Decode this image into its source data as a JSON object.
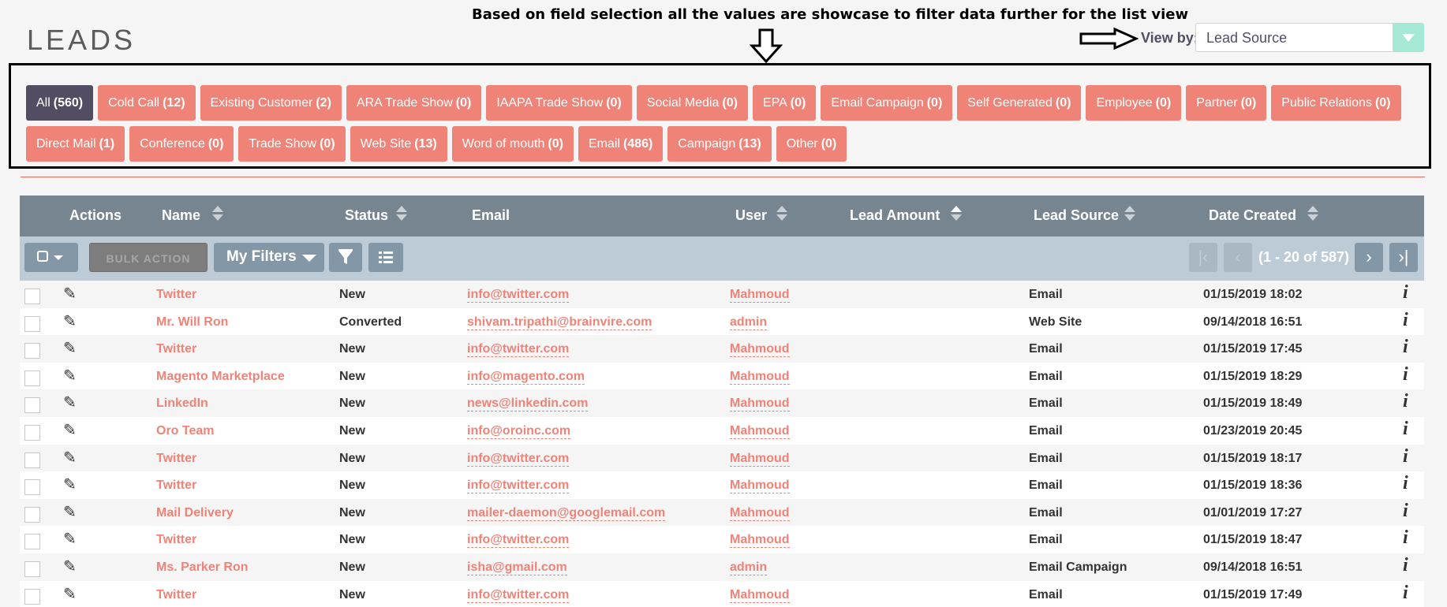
{
  "annotation": "Based on field selection all the values are showcase to filter data further for the list view",
  "page_title": "LEADS",
  "view_by": {
    "label": "View by:",
    "value": "Lead Source"
  },
  "pills": [
    {
      "name": "All",
      "count": "(560)",
      "active": true
    },
    {
      "name": "Cold Call",
      "count": "(12)"
    },
    {
      "name": "Existing Customer",
      "count": "(2)"
    },
    {
      "name": "ARA Trade Show",
      "count": "(0)"
    },
    {
      "name": "IAAPA Trade Show",
      "count": "(0)"
    },
    {
      "name": "Social Media",
      "count": "(0)"
    },
    {
      "name": "EPA",
      "count": "(0)"
    },
    {
      "name": "Email Campaign",
      "count": "(0)"
    },
    {
      "name": "Self Generated",
      "count": "(0)"
    },
    {
      "name": "Employee",
      "count": "(0)"
    },
    {
      "name": "Partner",
      "count": "(0)"
    },
    {
      "name": "Public Relations",
      "count": "(0)"
    },
    {
      "name": "Direct Mail",
      "count": "(1)"
    },
    {
      "name": "Conference",
      "count": "(0)"
    },
    {
      "name": "Trade Show",
      "count": "(0)"
    },
    {
      "name": "Web Site",
      "count": "(13)"
    },
    {
      "name": "Word of mouth",
      "count": "(0)"
    },
    {
      "name": "Email",
      "count": "(486)"
    },
    {
      "name": "Campaign",
      "count": "(13)"
    },
    {
      "name": "Other",
      "count": "(0)"
    }
  ],
  "columns": {
    "actions": "Actions",
    "name": "Name",
    "status": "Status",
    "email": "Email",
    "user": "User",
    "lead_amount": "Lead Amount",
    "lead_source": "Lead Source",
    "date_created": "Date Created"
  },
  "toolbar": {
    "bulk_action": "BULK ACTION",
    "my_filters": "My Filters",
    "pagination": "(1 - 20 of 587)"
  },
  "icons": {
    "first": "first-page-icon",
    "prev": "prev-page-icon",
    "next": "next-page-icon",
    "last": "last-page-icon"
  },
  "rows": [
    {
      "name": "Twitter",
      "status": "New",
      "email": "info@twitter.com",
      "user": "Mahmoud",
      "source": "Email",
      "date": "01/15/2019 18:02"
    },
    {
      "name": "Mr. Will Ron",
      "status": "Converted",
      "email": "shivam.tripathi@brainvire.com",
      "user": "admin",
      "source": "Web Site",
      "date": "09/14/2018 16:51"
    },
    {
      "name": "Twitter",
      "status": "New",
      "email": "info@twitter.com",
      "user": "Mahmoud",
      "source": "Email",
      "date": "01/15/2019 17:45"
    },
    {
      "name": "Magento Marketplace",
      "status": "New",
      "email": "info@magento.com",
      "user": "Mahmoud",
      "source": "Email",
      "date": "01/15/2019 18:29"
    },
    {
      "name": "LinkedIn",
      "status": "New",
      "email": "news@linkedin.com",
      "user": "Mahmoud",
      "source": "Email",
      "date": "01/15/2019 18:49"
    },
    {
      "name": "Oro Team",
      "status": "New",
      "email": "info@oroinc.com",
      "user": "Mahmoud",
      "source": "Email",
      "date": "01/23/2019 20:45"
    },
    {
      "name": "Twitter",
      "status": "New",
      "email": "info@twitter.com",
      "user": "Mahmoud",
      "source": "Email",
      "date": "01/15/2019 18:17"
    },
    {
      "name": "Twitter",
      "status": "New",
      "email": "info@twitter.com",
      "user": "Mahmoud",
      "source": "Email",
      "date": "01/15/2019 18:36"
    },
    {
      "name": "Mail Delivery",
      "status": "New",
      "email": "mailer-daemon@googlemail.com",
      "user": "Mahmoud",
      "source": "Email",
      "date": "01/01/2019 17:27"
    },
    {
      "name": "Twitter",
      "status": "New",
      "email": "info@twitter.com",
      "user": "Mahmoud",
      "source": "Email",
      "date": "01/15/2019 18:47"
    },
    {
      "name": "Ms. Parker Ron",
      "status": "New",
      "email": "isha@gmail.com",
      "user": "admin",
      "source": "Email Campaign",
      "date": "09/14/2018 16:51"
    },
    {
      "name": "Twitter",
      "status": "New",
      "email": "info@twitter.com",
      "user": "Mahmoud",
      "source": "Email",
      "date": "01/15/2019 17:49"
    }
  ]
}
